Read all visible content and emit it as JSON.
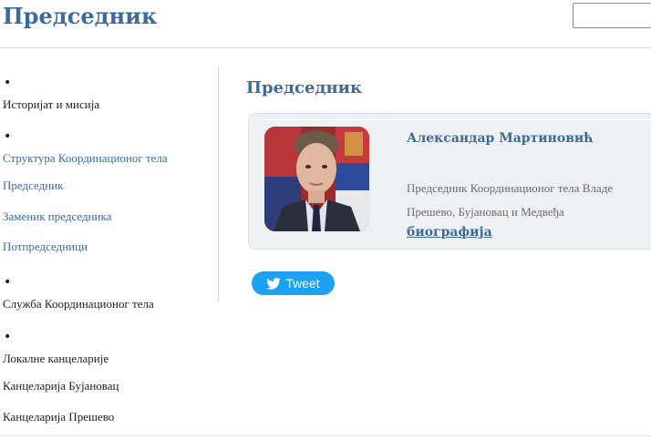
{
  "header": {
    "title": "Председник",
    "search_value": ""
  },
  "sidebar": {
    "history": "Историјат и мисија",
    "structure": "Структура Координационог тела",
    "president": "Председник",
    "deputy": "Заменик председника",
    "vice_presidents": "Потпредседници",
    "service": "Служба Координационог тела",
    "local_offices": "Локалне канцеларије",
    "office_bujanovac": "Канцеларија Бујановац",
    "office_presevo": "Канцеларија Прешево"
  },
  "main": {
    "section_title": "Председник",
    "person": {
      "name": "Александар Мартиновић",
      "role_line1": "Председник Координационог тела Владе",
      "role_line2": "Прешево, Бујановац и Медвеђа",
      "bio_link": "биографија"
    },
    "tweet_label": "Tweet"
  },
  "colors": {
    "accent": "#3d6a96",
    "twitter": "#1da1f2",
    "card_bg": "#eef1f3"
  },
  "icons": {
    "tweet": "twitter-bird-icon"
  }
}
